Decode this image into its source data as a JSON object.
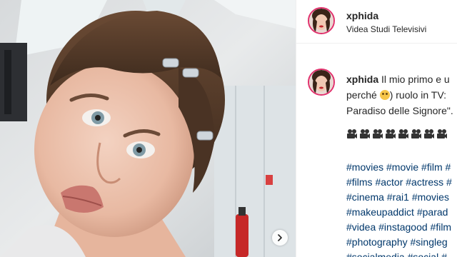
{
  "post": {
    "username": "xphida",
    "location": "Videa Studi Televisivi"
  },
  "caption": {
    "username": "xphida",
    "line1": "Il mio primo e u",
    "line2a": "perché ",
    "line2b": ") ruolo in TV:",
    "line3": "Paradiso delle Signore\"."
  },
  "movie_icons": [
    "movie-camera",
    "movie-camera",
    "movie-camera",
    "movie-camera",
    "movie-camera",
    "movie-camera",
    "movie-camera",
    "movie-camera"
  ],
  "hashtags": [
    "#movies #movie #film #",
    "#films #actor #actress #",
    "#cinema #rai1 #movies",
    "#makeupaddict #parad",
    "#videa #instagood #film",
    "#photography #singleg",
    "#socialmedia #social #"
  ],
  "colors": {
    "text": "#262626",
    "hashtag": "#00376b",
    "avatar_ring": "#e1306c",
    "border": "#efefef"
  },
  "icons": {
    "next": "chevron-right-icon",
    "emoji": "rolling-laughing-emoji-icon"
  }
}
